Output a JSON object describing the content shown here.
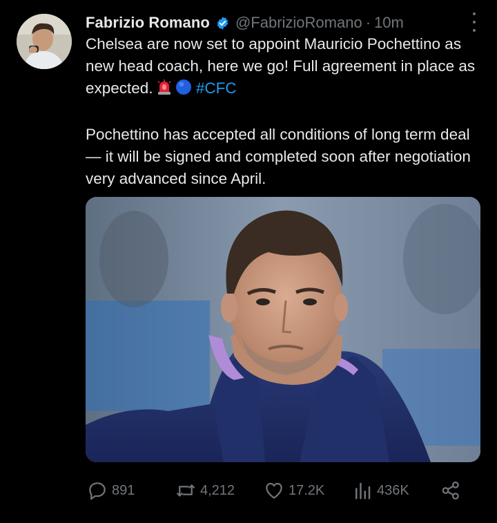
{
  "tweet": {
    "author_name": "Fabrizio Romano",
    "handle": "@FabrizioRomano",
    "separator": "·",
    "time": "10m",
    "paragraphs": [
      "Chelsea are now set to appoint Mauricio Pochettino as new head coach, here we go! Full agreement in place as expected.",
      "Pochettino has accepted all conditions of long term deal — it will be signed and completed soon after negotiation very advanced since April."
    ],
    "hashtag": "#CFC",
    "emojis": [
      "siren-emoji",
      "blue-circle-emoji"
    ]
  },
  "metrics": {
    "replies": "891",
    "reposts": "4,212",
    "likes": "17.2K",
    "views": "436K"
  },
  "icons": {
    "verified": "verified-badge-icon",
    "more": "more-options-icon",
    "reply": "reply-icon",
    "repost": "repost-icon",
    "like": "heart-icon",
    "views": "views-icon",
    "share": "share-icon"
  },
  "colors": {
    "background": "#000000",
    "text": "#e7e9ea",
    "muted": "#71767b",
    "accent": "#1d9bf0"
  }
}
